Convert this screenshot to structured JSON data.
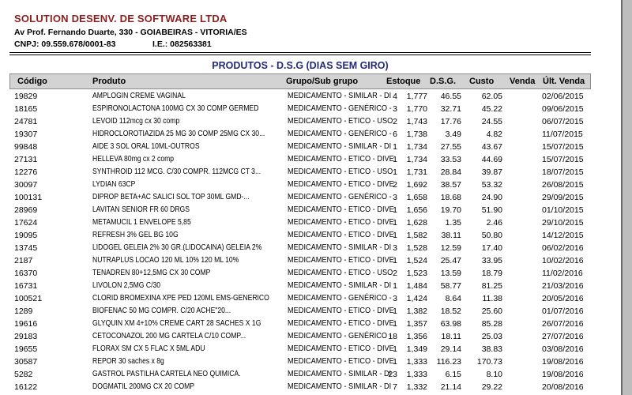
{
  "company": {
    "name": "SOLUTION DESENV. DE SOFTWARE LTDA",
    "address": "Av Prof. Fernando Duarte, 330 - GOIABEIRAS - VITORIA/ES",
    "cnpj": "CNPJ: 09.559.678/0001-83",
    "ie": "I.E.: 082563381"
  },
  "report": {
    "title": "PRODUTOS - D.S.G (DIAS SEM GIRO)"
  },
  "colors": {
    "company_name": "#8b1f1f",
    "report_title": "#232c78",
    "header_background": "#d3d3d3"
  },
  "table": {
    "columns": {
      "codigo": "Código",
      "produto": "Produto",
      "grupo": "Grupo/Sub grupo",
      "estoque": "Estoque",
      "dsg": "D.S.G.",
      "custo": "Custo",
      "venda": "Venda",
      "ult_venda": "Últ. Venda"
    },
    "rows": [
      {
        "codigo": "19829",
        "produto": "AMPLOGIN CREME VAGINAL",
        "grupo": "MEDICAMENTO - SIMILAR - DI",
        "estoque": "4",
        "dsg": "1,777",
        "custo": "46.55",
        "venda": "62.05",
        "ult_venda": "02/06/2015"
      },
      {
        "codigo": "18165",
        "produto": "ESPIRONOLACTONA 100MG CX 30 COMP GERMED",
        "grupo": "MEDICAMENTO - GENÉRICO -",
        "estoque": "3",
        "dsg": "1,770",
        "custo": "32.71",
        "venda": "45.22",
        "ult_venda": "09/06/2015"
      },
      {
        "codigo": "24781",
        "produto": "LEVOID 112mcg cx 30 comp",
        "grupo": "MEDICAMENTO - ETICO - USO",
        "estoque": "2",
        "dsg": "1,743",
        "custo": "17.76",
        "venda": "24.55",
        "ult_venda": "06/07/2015"
      },
      {
        "codigo": "19307",
        "produto": "HIDROCLOROTIAZIDA 25 MG 30 COMP 25MG CX 30...",
        "grupo": "MEDICAMENTO - GENÉRICO -",
        "estoque": "6",
        "dsg": "1,738",
        "custo": "3.49",
        "venda": "4.82",
        "ult_venda": "11/07/2015"
      },
      {
        "codigo": "99848",
        "produto": "AIDE 3 SOL ORAL 10ML-OUTROS",
        "grupo": "MEDICAMENTO - SIMILAR - DI",
        "estoque": "1",
        "dsg": "1,734",
        "custo": "27.55",
        "venda": "43.67",
        "ult_venda": "15/07/2015"
      },
      {
        "codigo": "27131",
        "produto": "HELLEVA 80mg cx 2 comp",
        "grupo": "MEDICAMENTO - ETICO - DIVE",
        "estoque": "1",
        "dsg": "1,734",
        "custo": "33.53",
        "venda": "44.69",
        "ult_venda": "15/07/2015"
      },
      {
        "codigo": "12276",
        "produto": "SYNTHROID 112 MCG. C/30 COMPR. 112MCG CT 3...",
        "grupo": "MEDICAMENTO - ETICO - USO",
        "estoque": "1",
        "dsg": "1,731",
        "custo": "28.84",
        "venda": "39.87",
        "ult_venda": "18/07/2015"
      },
      {
        "codigo": "30097",
        "produto": "LYDIAN 63CP",
        "grupo": "MEDICAMENTO - ETICO - DIVE",
        "estoque": "2",
        "dsg": "1,692",
        "custo": "38.57",
        "venda": "53.32",
        "ult_venda": "26/08/2015"
      },
      {
        "codigo": "100131",
        "produto": "DIPROP BETA+AC SALICI SOL TOP 30ML GMD-...",
        "grupo": "MEDICAMENTO - GENÉRICO -",
        "estoque": "3",
        "dsg": "1,658",
        "custo": "18.68",
        "venda": "24.90",
        "ult_venda": "29/09/2015"
      },
      {
        "codigo": "28969",
        "produto": "LAVITAN SENIOR FR 60 DRGS",
        "grupo": "MEDICAMENTO - ETICO - DIVE",
        "estoque": "1",
        "dsg": "1,656",
        "custo": "19.70",
        "venda": "51.90",
        "ult_venda": "01/10/2015"
      },
      {
        "codigo": "17624",
        "produto": "METAMUCIL 1 ENVELOPE 5,85",
        "grupo": "MEDICAMENTO - ETICO - DIVE",
        "estoque": "1",
        "dsg": "1,628",
        "custo": "1.35",
        "venda": "2.46",
        "ult_venda": "29/10/2015"
      },
      {
        "codigo": "19095",
        "produto": "REFRESH 3% GEL BG 10G",
        "grupo": "MEDICAMENTO - ETICO - DIVE",
        "estoque": "1",
        "dsg": "1,582",
        "custo": "38.11",
        "venda": "50.80",
        "ult_venda": "14/12/2015"
      },
      {
        "codigo": "13745",
        "produto": "LIDOGEL GELEIA 2% 30 GR.(LIDOCAINA) GELEIA 2%",
        "grupo": "MEDICAMENTO - SIMILAR - DI",
        "estoque": "3",
        "dsg": "1,528",
        "custo": "12.59",
        "venda": "17.40",
        "ult_venda": "06/02/2016"
      },
      {
        "codigo": "2187",
        "produto": "NUTRAPLUS LOCAO 120 ML 10% 120 ML 10%",
        "grupo": "MEDICAMENTO - ETICO - DIVE",
        "estoque": "1",
        "dsg": "1,524",
        "custo": "25.47",
        "venda": "33.95",
        "ult_venda": "10/02/2016"
      },
      {
        "codigo": "16370",
        "produto": "TENADREN 80+12,5MG CX 30 COMP",
        "grupo": "MEDICAMENTO - ETICO - USO",
        "estoque": "2",
        "dsg": "1,523",
        "custo": "13.59",
        "venda": "18.79",
        "ult_venda": "11/02/2016"
      },
      {
        "codigo": "16731",
        "produto": "LIVOLON 2,5MG C/30",
        "grupo": "MEDICAMENTO - SIMILAR - DI",
        "estoque": "1",
        "dsg": "1,484",
        "custo": "58.77",
        "venda": "81.25",
        "ult_venda": "21/03/2016"
      },
      {
        "codigo": "100521",
        "produto": "CLORID BROMEXINA XPE PED 120ML EMS-GENERICO",
        "grupo": "MEDICAMENTO - GENÉRICO -",
        "estoque": "3",
        "dsg": "1,424",
        "custo": "8.64",
        "venda": "11.38",
        "ult_venda": "20/05/2016"
      },
      {
        "codigo": "1289",
        "produto": "BIOFENAC 50 MG COMPR. C/20 ACHE\"20...",
        "grupo": "MEDICAMENTO - ETICO - DIVE",
        "estoque": "1",
        "dsg": "1,382",
        "custo": "18.52",
        "venda": "25.60",
        "ult_venda": "01/07/2016"
      },
      {
        "codigo": "19616",
        "produto": "GLYQUIN XM 4+10% CREME CART 28 SACHES X 1G",
        "grupo": "MEDICAMENTO - ETICO - DIVE",
        "estoque": "1",
        "dsg": "1,357",
        "custo": "63.98",
        "venda": "85.28",
        "ult_venda": "26/07/2016"
      },
      {
        "codigo": "29183",
        "produto": "CETOCONAZOL 200 MG CARTELA C/10 COMP...",
        "grupo": "MEDICAMENTO - GENÉRICO -",
        "estoque": "18",
        "dsg": "1,356",
        "custo": "18.11",
        "venda": "25.03",
        "ult_venda": "27/07/2016"
      },
      {
        "codigo": "19655",
        "produto": "FLORAX SM CX 5 FLAC X 5ML ADU",
        "grupo": "MEDICAMENTO - ETICO - DIVE",
        "estoque": "1",
        "dsg": "1,349",
        "custo": "29.14",
        "venda": "38.83",
        "ult_venda": "03/08/2016"
      },
      {
        "codigo": "30587",
        "produto": "REPOR 30 saches x 8g",
        "grupo": "MEDICAMENTO - ETICO - DIVE",
        "estoque": "1",
        "dsg": "1,333",
        "custo": "116.23",
        "venda": "170.73",
        "ult_venda": "19/08/2016"
      },
      {
        "codigo": "5282",
        "produto": "GASTROL PASTILHA CARTELA NEO QUIMICA.",
        "grupo": "MEDICAMENTO - SIMILAR - DI",
        "estoque": "23",
        "dsg": "1,333",
        "custo": "6.15",
        "venda": "8.10",
        "ult_venda": "19/08/2016"
      },
      {
        "codigo": "16122",
        "produto": "DOGMATIL 200MG CX 20 COMP",
        "grupo": "MEDICAMENTO - SIMILAR - DI",
        "estoque": "7",
        "dsg": "1,332",
        "custo": "21.14",
        "venda": "29.22",
        "ult_venda": "20/08/2016"
      }
    ]
  }
}
